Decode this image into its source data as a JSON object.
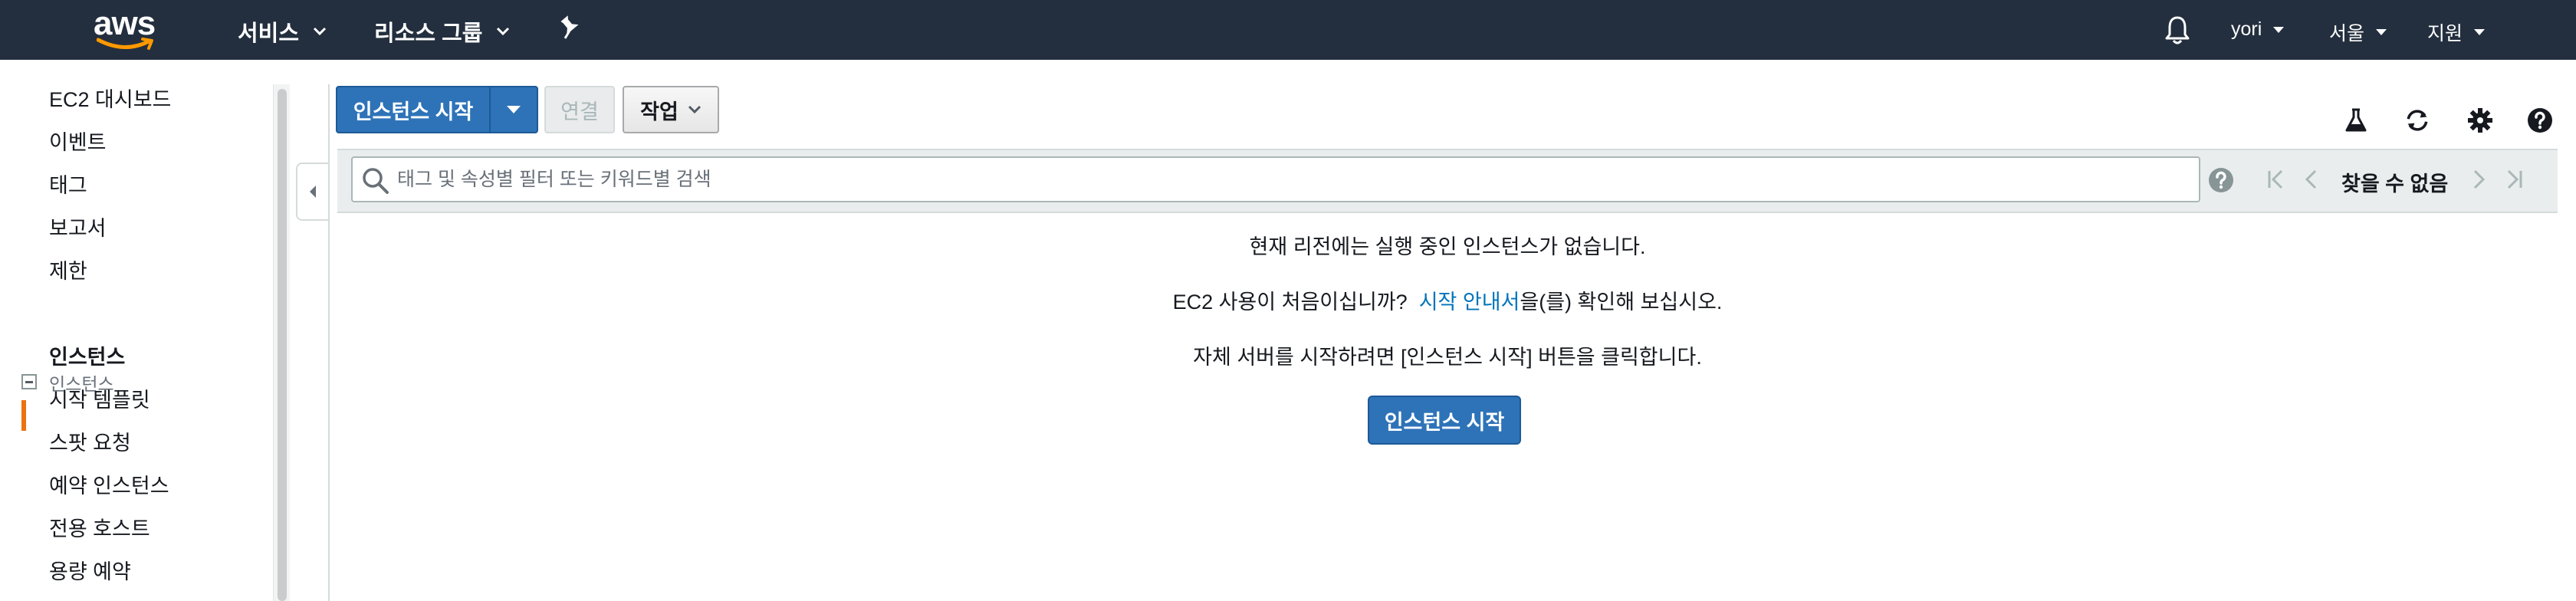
{
  "topnav": {
    "logo_text": "aws",
    "services_label": "서비스",
    "resource_groups_label": "리소스 그룹",
    "user_label": "yori",
    "region_label": "서울",
    "support_label": "지원"
  },
  "sidebar": {
    "items_top": [
      "EC2 대시보드",
      "이벤트",
      "태그",
      "보고서",
      "제한"
    ],
    "section_label": "인스턴스",
    "items_section": [
      "인스턴스",
      "시작 템플릿",
      "스팟 요청",
      "예약 인스턴스",
      "전용 호스트",
      "용량 예약"
    ],
    "active_item": "인스턴스"
  },
  "toolbar": {
    "launch_label": "인스턴스 시작",
    "connect_label": "연결",
    "actions_label": "작업"
  },
  "filter": {
    "placeholder": "태그 및 속성별 필터 또는 키워드별 검색",
    "pager_status": "찾을 수 없음"
  },
  "empty_state": {
    "line1": "현재 리전에는 실행 중인 인스턴스가 없습니다.",
    "line2_prefix": "EC2 사용이 처음이십니까?",
    "line2_link": "시작 안내서",
    "line2_suffix": "을(를) 확인해 보십시오.",
    "line3": "자체 서버를 시작하려면 [인스턴스 시작] 버튼을 클릭합니다.",
    "cta_label": "인스턴스 시작"
  },
  "icons": {
    "bell": "bell-icon",
    "pin": "pin-icon",
    "flask": "flask-icon",
    "refresh": "refresh-icon",
    "gear": "gear-icon",
    "help": "help-icon",
    "search": "search-icon"
  },
  "colors": {
    "nav_bg": "#232f3e",
    "primary": "#2e73b8",
    "link": "#0073bb",
    "active_marker": "#ec7211"
  }
}
